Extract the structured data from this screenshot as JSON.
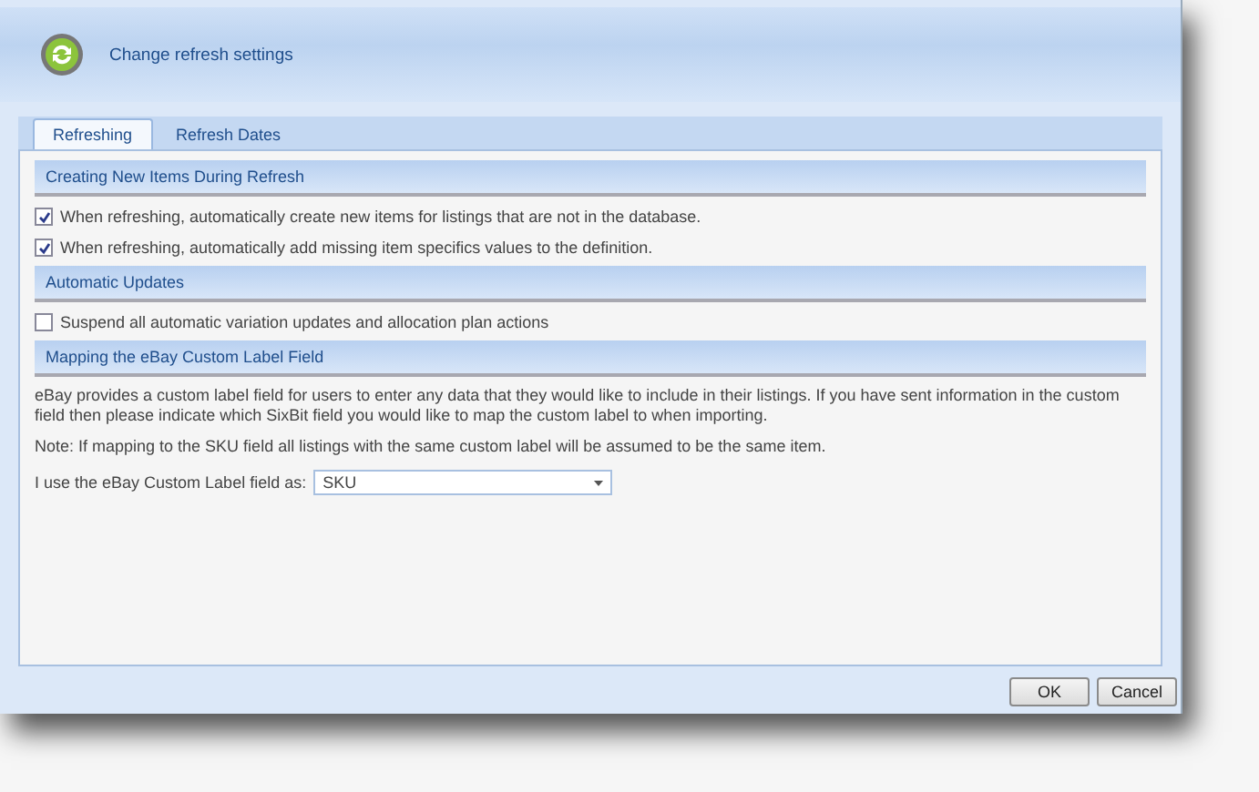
{
  "header": {
    "title": "Change refresh settings"
  },
  "tabs": [
    {
      "label": "Refreshing",
      "selected": true
    },
    {
      "label": "Refresh Dates",
      "selected": false
    }
  ],
  "sections": [
    {
      "title": "Creating New Items During Refresh",
      "items": [
        {
          "kind": "checkbox",
          "label": "When refreshing, automatically create new items for listings that are not in the database.",
          "checked": true
        },
        {
          "kind": "checkbox",
          "label": "When refreshing, automatically add missing item specifics values to the definition.",
          "checked": true
        }
      ]
    },
    {
      "title": "Automatic Updates",
      "items": [
        {
          "kind": "checkbox",
          "label": "Suspend all automatic variation updates and allocation plan actions",
          "checked": false
        }
      ]
    },
    {
      "title": "Mapping the eBay Custom Label Field",
      "items": [
        {
          "kind": "text",
          "label": "eBay provides a custom label field for users to enter any data that they would like to include in their listings.  If you have sent information in the custom field then please indicate which SixBit field you would like to map the custom label to when importing."
        },
        {
          "kind": "text",
          "label": "Note: If mapping to the SKU field all listings with the same custom label will be assumed to be the same item."
        },
        {
          "kind": "dropdown",
          "label": "I use the eBay Custom Label field as:",
          "value": "SKU"
        }
      ]
    }
  ],
  "buttons": [
    "OK",
    "Cancel"
  ]
}
